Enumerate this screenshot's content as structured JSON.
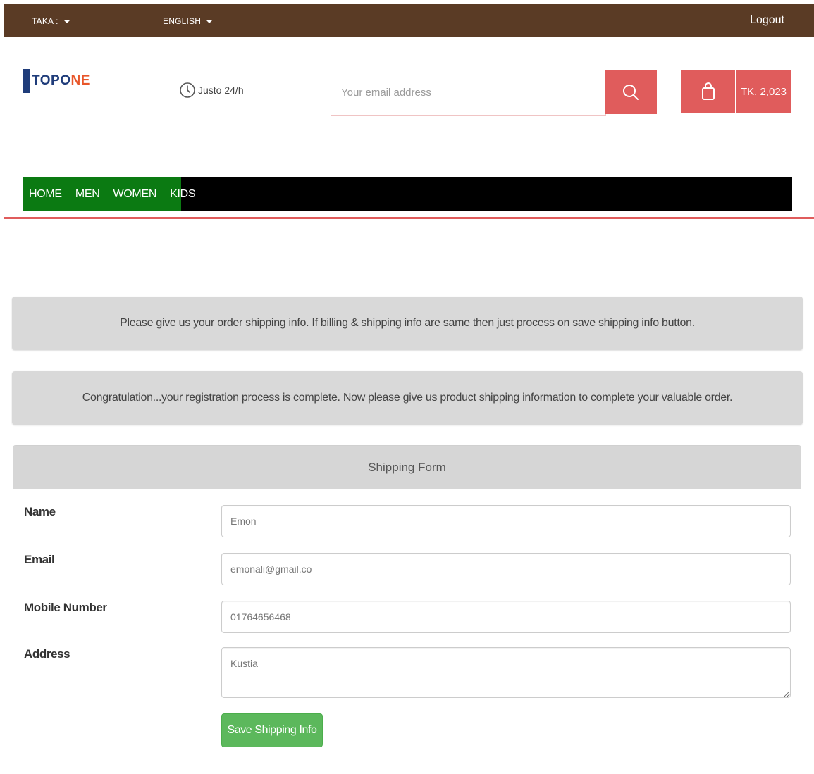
{
  "topbar": {
    "currency": "TAKA :",
    "language": "ENGLISH",
    "logout": "Logout"
  },
  "brand": {
    "logo_part1": "TOPO",
    "logo_part2": "NE"
  },
  "hours": {
    "text": "Justo 24/h"
  },
  "search": {
    "placeholder": "Your email address"
  },
  "cart": {
    "total": "TK. 2,023"
  },
  "nav": {
    "items": [
      "HOME",
      "MEN",
      "WOMEN",
      "KIDS"
    ]
  },
  "alerts": {
    "shipping_info": "Please give us your order shipping info. If billing & shipping info are same then just process on save shipping info button.",
    "registration": "Congratulation...your registration process is complete. Now please give us product shipping information to complete your valuable order."
  },
  "form": {
    "title": "Shipping Form",
    "name_label": "Name",
    "name_value": "Emon",
    "email_label": "Email",
    "email_value": "emonali@gmail.co",
    "mobile_label": "Mobile Number",
    "mobile_value": "01764656468",
    "address_label": "Address",
    "address_value": "Kustia",
    "save_label": "Save Shipping Info"
  },
  "colors": {
    "topbar": "#5a3b25",
    "accent": "#e05c5c",
    "nav_green": "#0b7a12",
    "save_green": "#5cb85c"
  }
}
